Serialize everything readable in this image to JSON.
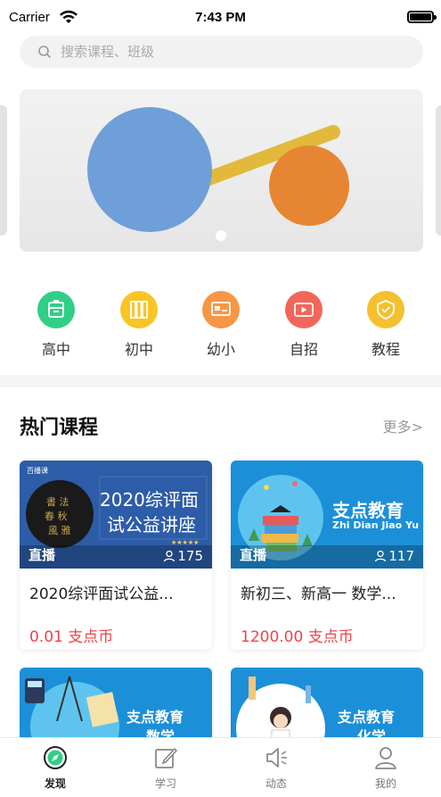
{
  "status_bar": {
    "carrier": "Carrier",
    "time": "7:43 PM"
  },
  "search": {
    "placeholder": "搜索课程、班级"
  },
  "categories": [
    {
      "label": "高中",
      "icon": "school-bag-icon",
      "color": "#2fcf86"
    },
    {
      "label": "初中",
      "icon": "books-icon",
      "color": "#f8c525"
    },
    {
      "label": "幼小",
      "icon": "blackboard-icon",
      "color": "#f79644"
    },
    {
      "label": "自招",
      "icon": "video-play-icon",
      "color": "#f2665a"
    },
    {
      "label": "教程",
      "icon": "shield-check-icon",
      "color": "#f5c02e"
    }
  ],
  "hot_courses": {
    "title": "热门课程",
    "more": "更多>",
    "items": [
      {
        "thumb_heading": "2020综评面试公益讲座",
        "thumb_heading_line1": "2020综评面",
        "thumb_heading_line2": "试公益讲座",
        "thumb_brand": "百播课",
        "live": "直播",
        "viewers": "175",
        "title": "2020综评面试公益...",
        "price": "0.01 支点币"
      },
      {
        "thumb_heading": "支点教育",
        "thumb_sub": "Zhi Dian Jiao Yu",
        "live": "直播",
        "viewers": "117",
        "title": "新初三、新高一 数学...",
        "price": "1200.00 支点币"
      },
      {
        "thumb_heading": "支点教育",
        "thumb_sub": "数学"
      },
      {
        "thumb_heading": "支点教育",
        "thumb_sub": "化学"
      }
    ]
  },
  "tabbar": {
    "tabs": [
      {
        "label": "发现",
        "icon": "compass-icon",
        "active": true
      },
      {
        "label": "学习",
        "icon": "edit-icon",
        "active": false
      },
      {
        "label": "动态",
        "icon": "speaker-icon",
        "active": false
      },
      {
        "label": "我的",
        "icon": "user-icon",
        "active": false
      }
    ]
  },
  "colors": {
    "accent_green": "#2fcf86",
    "price_red": "#f0434a",
    "card_blue": "#1c8fd9",
    "card_dark_blue": "#2a5aa8"
  }
}
